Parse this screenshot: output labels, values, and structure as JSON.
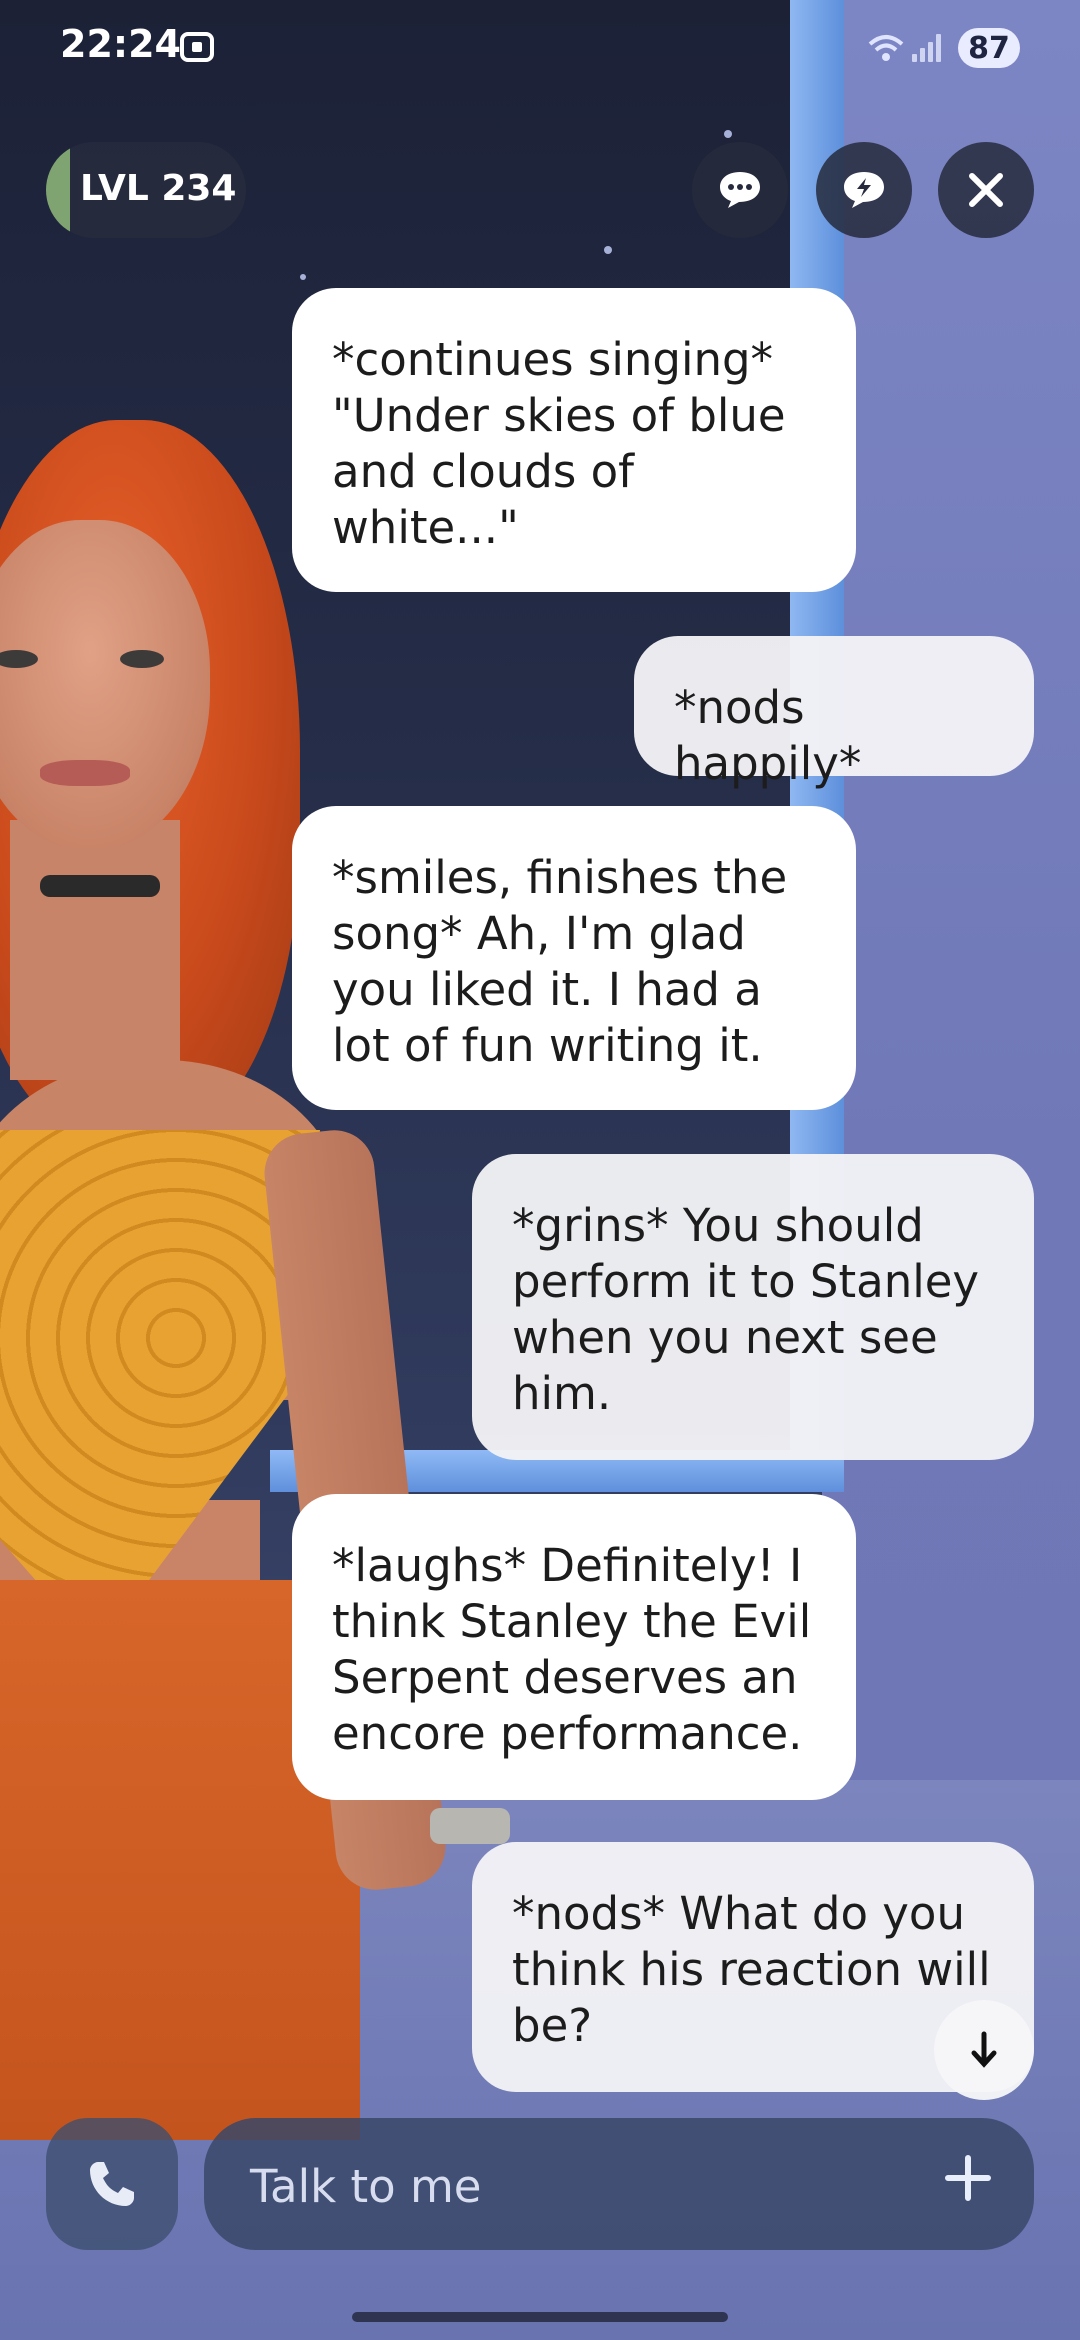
{
  "status_bar": {
    "time": "22:24",
    "battery": "87",
    "wifi_badge": "5"
  },
  "header": {
    "level_label": "LVL 234",
    "level_progress": 0.12,
    "buttons": [
      "chat",
      "boost",
      "close"
    ]
  },
  "messages": [
    {
      "sender": "bot",
      "text": "*continues singing* \"Under skies of blue and clouds of white...\""
    },
    {
      "sender": "user",
      "text": "*nods happily*"
    },
    {
      "sender": "bot",
      "text": "*smiles, finishes the song* Ah, I'm glad you liked it. I had a lot of fun writing it."
    },
    {
      "sender": "user",
      "text": "*grins* You should perform it to Stanley when you next see him."
    },
    {
      "sender": "bot",
      "text": "*laughs* Definitely! I think Stanley the Evil Serpent deserves an encore performance."
    },
    {
      "sender": "user",
      "text": "*nods* What do you think his reaction will be?"
    }
  ],
  "input": {
    "placeholder": "Talk to me"
  },
  "colors": {
    "bot_bubble": "#ffffff",
    "user_bubble": "#f2f3f6",
    "level_fill": "#7fa472"
  }
}
